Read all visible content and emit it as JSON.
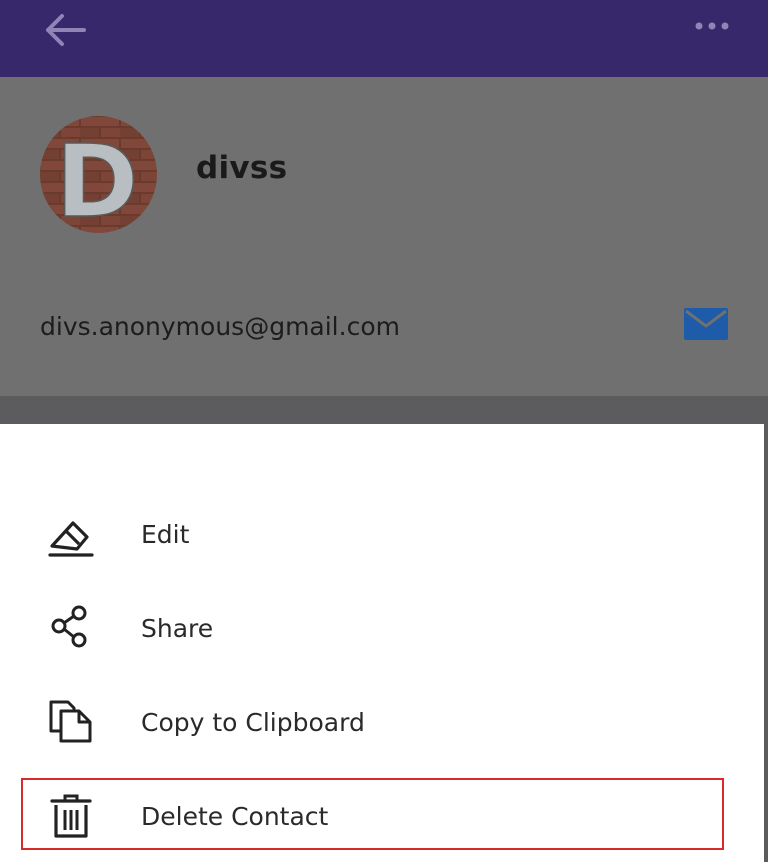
{
  "contact": {
    "name": "divss",
    "avatar_letter": "D",
    "email": "divs.anonymous@gmail.com"
  },
  "menu": {
    "items": [
      {
        "label": "Edit",
        "icon": "pencil-icon"
      },
      {
        "label": "Share",
        "icon": "share-icon"
      },
      {
        "label": "Copy to Clipboard",
        "icon": "copy-icon"
      },
      {
        "label": "Delete Contact",
        "icon": "trash-icon"
      }
    ]
  },
  "colors": {
    "appbar": "#37286b",
    "overlay": "#707070",
    "mail_icon": "#1e5ba8",
    "highlight": "#d82a2a"
  }
}
